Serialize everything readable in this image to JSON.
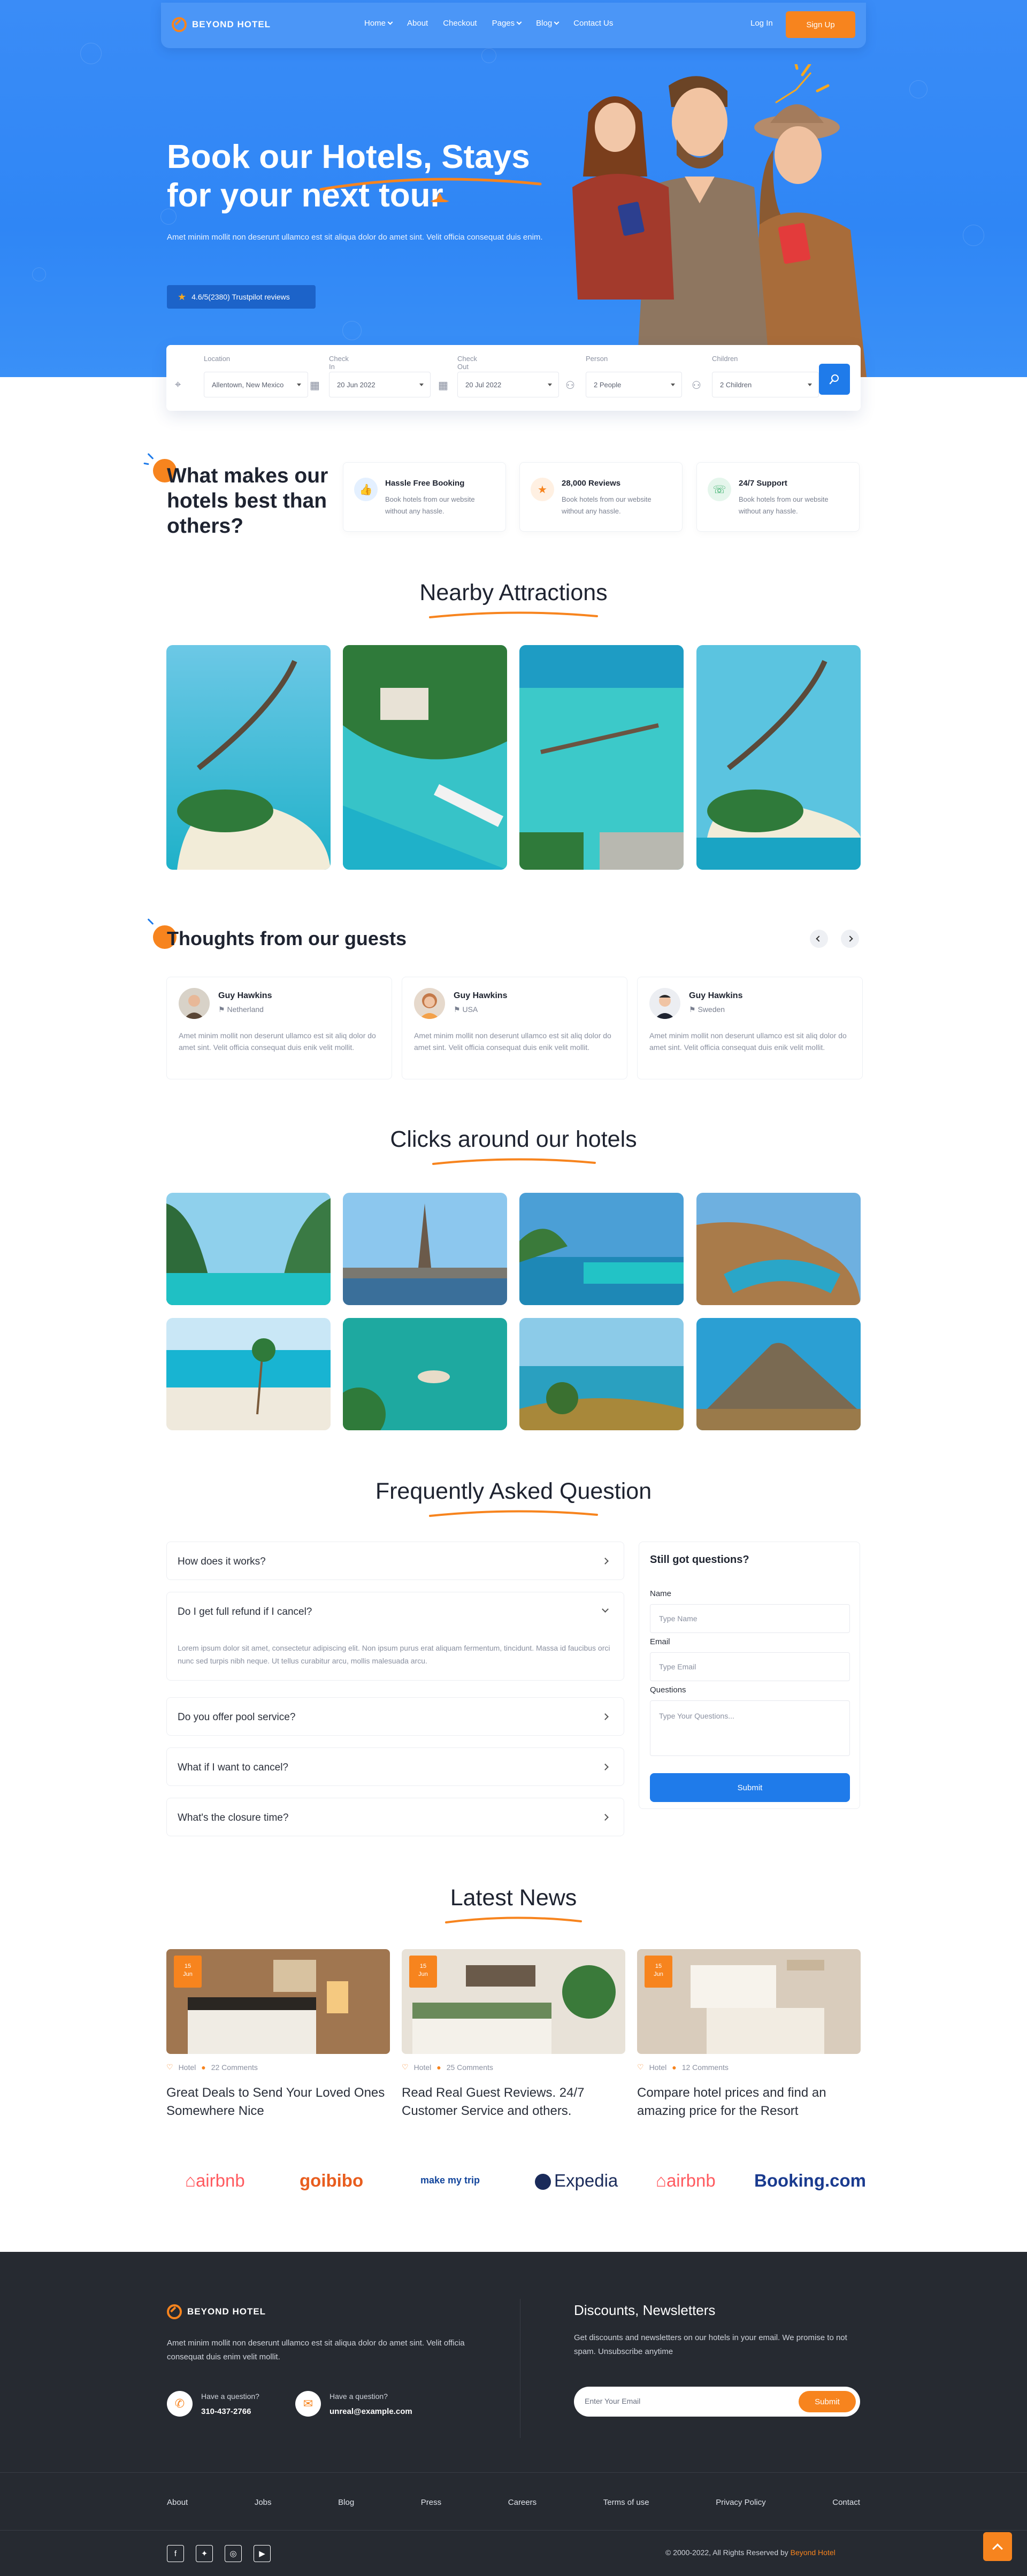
{
  "brand": {
    "name": "BEYOND HOTEL"
  },
  "nav": {
    "items": [
      "Home",
      "About",
      "Checkout",
      "Pages",
      "Blog",
      "Contact Us"
    ],
    "login": "Log In",
    "signup": "Sign Up"
  },
  "hero": {
    "title_line1": "Book our Hotels, Stays",
    "title_line2": "for your next tour",
    "subtitle": "Amet minim mollit non deserunt ullamco est sit aliqua dolor do amet sint. Velit officia consequat duis enim.",
    "rating": "4.6/5(2380) Trustpilot reviews"
  },
  "search": {
    "location_label": "Location",
    "location_value": "Allentown, New Mexico",
    "checkin_label": "Check In",
    "checkin_value": "20 Jun 2022",
    "checkout_label": "Check Out",
    "checkout_value": "20 Jul 2022",
    "person_label": "Person",
    "person_value": "2 People",
    "children_label": "Children",
    "children_value": "2 Children"
  },
  "why": {
    "title": "What makes our hotels best than others?",
    "features": [
      {
        "title": "Hassle Free Booking",
        "desc": "Book hotels from our website without any hassle.",
        "icon": "thumbs-up-icon",
        "color": "#e4f0ff",
        "iconColor": "#1f7bea"
      },
      {
        "title": "28,000 Reviews",
        "desc": "Book hotels from our website without any hassle.",
        "icon": "star-icon",
        "color": "#fff0e2",
        "iconColor": "#f7841e"
      },
      {
        "title": "24/7 Support",
        "desc": "Book hotels from our website without any hassle.",
        "icon": "headset-icon",
        "color": "#e5f6ec",
        "iconColor": "#2eaa62"
      }
    ]
  },
  "nearby": {
    "title": "Nearby Attractions"
  },
  "guests": {
    "title": "Thoughts from our guests",
    "items": [
      {
        "name": "Guy Hawkins",
        "country": "Netherland",
        "text": "Amet minim mollit non deserunt ullamco est sit aliq dolor do amet sint. Velit officia consequat duis enik velit mollit."
      },
      {
        "name": "Guy Hawkins",
        "country": "USA",
        "text": "Amet minim mollit non deserunt ullamco est sit aliq dolor do amet sint. Velit officia consequat duis enik velit mollit."
      },
      {
        "name": "Guy Hawkins",
        "country": "Sweden",
        "text": "Amet minim mollit non deserunt ullamco est sit aliq dolor do amet sint. Velit officia consequat duis enik velit mollit."
      }
    ]
  },
  "clicks": {
    "title": "Clicks around our hotels"
  },
  "faq": {
    "title": "Frequently Asked Question",
    "items": [
      "How does it works?",
      "Do I get full refund if I cancel?",
      "Do you offer pool service?",
      "What if I want to cancel?",
      "What's the closure time?"
    ],
    "answer": "Lorem ipsum dolor sit amet, consectetur adipiscing elit. Non ipsum purus erat aliquam fermentum, tincidunt. Massa id faucibus orci nunc sed turpis nibh neque. Ut tellus curabitur arcu, mollis malesuada arcu."
  },
  "form": {
    "title": "Still got questions?",
    "name_label": "Name",
    "name_placeholder": "Type Name",
    "email_label": "Email",
    "email_placeholder": "Type Email",
    "q_label": "Questions",
    "q_placeholder": "Type Your Questions...",
    "submit": "Submit"
  },
  "news": {
    "title": "Latest News",
    "items": [
      {
        "day": "15",
        "month": "Jun",
        "category": "Hotel",
        "comments": "22 Comments",
        "title": "Great Deals to Send Your Loved Ones Somewhere Nice"
      },
      {
        "day": "15",
        "month": "Jun",
        "category": "Hotel",
        "comments": "25 Comments",
        "title": "Read Real Guest Reviews. 24/7 Customer Service and others."
      },
      {
        "day": "15",
        "month": "Jun",
        "category": "Hotel",
        "comments": "12 Comments",
        "title": "Compare hotel prices and find an amazing price for the Resort"
      }
    ]
  },
  "partners": [
    "airbnb",
    "goibibo",
    "make my trip",
    "Expedia",
    "airbnb",
    "Booking.com"
  ],
  "footer": {
    "about": "Amet minim mollit non deserunt ullamco est sit aliqua dolor do amet sint. Velit officia consequat duis enim velit mollit.",
    "contact1_label": "Have a question?",
    "contact1_value": "310-437-2766",
    "contact2_label": "Have a question?",
    "contact2_value": "unreal@example.com",
    "newsletter_title": "Discounts, Newsletters",
    "newsletter_desc": "Get discounts and newsletters on our hotels in your email. We promise to not spam. Unsubscribe anytime",
    "email_placeholder": "Enter Your Email",
    "subscribe": "Submit",
    "links": [
      "About",
      "Jobs",
      "Blog",
      "Press",
      "Careers",
      "Terms of use",
      "Privacy Policy",
      "Contact"
    ],
    "copyright": "© 2000-2022, All Rights Reserved by",
    "copyright_brand": "Beyond Hotel"
  },
  "colors": {
    "primary": "#2f86f5",
    "accent": "#f7841e",
    "footer": "#262a31"
  }
}
